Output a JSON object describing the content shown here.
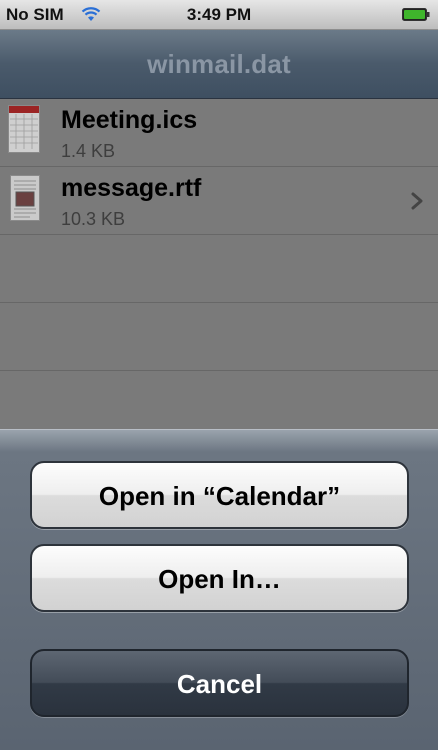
{
  "status_bar": {
    "carrier": "No SIM",
    "time": "3:49 PM",
    "wifi_icon": "wifi-icon",
    "battery_icon": "battery-icon"
  },
  "navbar": {
    "title": "winmail.dat"
  },
  "files": [
    {
      "name": "Meeting.ics",
      "size": "1.4 KB",
      "icon": "calendar-file-icon"
    },
    {
      "name": "message.rtf",
      "size": "10.3 KB",
      "icon": "document-file-icon",
      "disclosure_icon": "chevron-right-icon"
    }
  ],
  "action_sheet": {
    "open_in_calendar_label": "Open in “Calendar”",
    "open_in_label": "Open In…",
    "cancel_label": "Cancel"
  },
  "colors": {
    "navbar": "#4a5a6b",
    "battery": "#3fb52c",
    "wifi": "#2a6fd6",
    "calendar_header": "#b12a2a"
  }
}
